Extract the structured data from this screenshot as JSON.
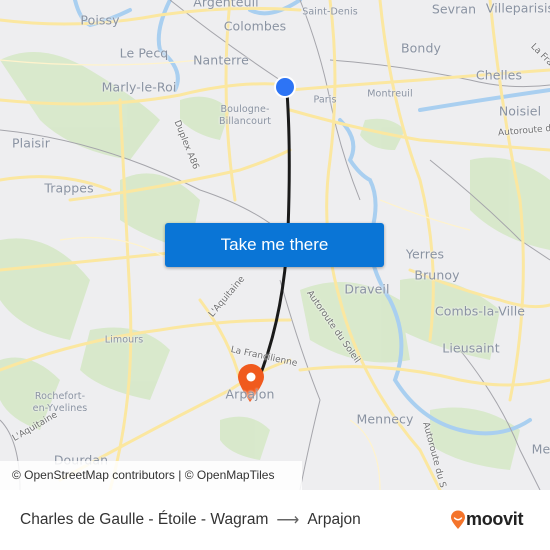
{
  "map": {
    "places": [
      {
        "id": "argenteuil",
        "name": "Argenteuil"
      },
      {
        "id": "poissy",
        "name": "Poissy"
      },
      {
        "id": "colombes",
        "name": "Colombes"
      },
      {
        "id": "saint-denis",
        "name": "Saint-Denis"
      },
      {
        "id": "sevran",
        "name": "Sevran"
      },
      {
        "id": "villeparisis",
        "name": "Villeparisis"
      },
      {
        "id": "le-pecq",
        "name": "Le Pecq"
      },
      {
        "id": "nanterre",
        "name": "Nanterre"
      },
      {
        "id": "bondy",
        "name": "Bondy"
      },
      {
        "id": "chelles",
        "name": "Chelles"
      },
      {
        "id": "marly-le-roi",
        "name": "Marly-le-Roi"
      },
      {
        "id": "paris",
        "name": "Paris"
      },
      {
        "id": "montreuil",
        "name": "Montreuil"
      },
      {
        "id": "noisiel",
        "name": "Noisiel"
      },
      {
        "id": "boulogne-billancourt",
        "name": "Boulogne-\nBillancourt"
      },
      {
        "id": "plaisir",
        "name": "Plaisir"
      },
      {
        "id": "trappes",
        "name": "Trappes"
      },
      {
        "id": "yerres",
        "name": "Yerres"
      },
      {
        "id": "brunoy",
        "name": "Brunoy"
      },
      {
        "id": "draveil",
        "name": "Draveil"
      },
      {
        "id": "combs-la-ville",
        "name": "Combs-la-Ville"
      },
      {
        "id": "limours",
        "name": "Limours"
      },
      {
        "id": "lieusaint",
        "name": "Lieusaint"
      },
      {
        "id": "rochefort-en-yvelines",
        "name": "Rochefort-\nen-Yvelines"
      },
      {
        "id": "arpajon",
        "name": "Arpajon"
      },
      {
        "id": "mennecy",
        "name": "Mennecy"
      },
      {
        "id": "dourdan",
        "name": "Dourdan"
      },
      {
        "id": "melun",
        "name": "Me"
      }
    ],
    "roads": [
      {
        "id": "duplex-a86",
        "name": "Duplex A86"
      },
      {
        "id": "autoroute-est",
        "name": "Autoroute de"
      },
      {
        "id": "la-francilienne-ne",
        "name": "La Fra"
      },
      {
        "id": "laquitaine-1",
        "name": "L'Aquitaine"
      },
      {
        "id": "laquitaine-2",
        "name": "L'Aquitaine"
      },
      {
        "id": "autoroute-du-soleil-1",
        "name": "Autoroute du Soleil"
      },
      {
        "id": "autoroute-du-soleil-2",
        "name": "Autoroute du S"
      },
      {
        "id": "la-francilienne",
        "name": "La Francilienne"
      }
    ],
    "origin": {
      "name": "Charles de Gaulle - Étoile - Wagram",
      "color": "#2d74f5"
    },
    "destination": {
      "name": "Arpajon",
      "color": "#f05a1e"
    },
    "route_color": "#1a1a1a"
  },
  "take_me_there": {
    "label": "Take me there",
    "color": "#0a75d6"
  },
  "attribution": "© OpenStreetMap contributors | © OpenMapTiles",
  "footer": {
    "origin": "Charles de Gaulle - Étoile - Wagram",
    "arrow": "⟶",
    "destination": "Arpajon",
    "brand": "moovit",
    "brand_color": "#f4742b"
  }
}
